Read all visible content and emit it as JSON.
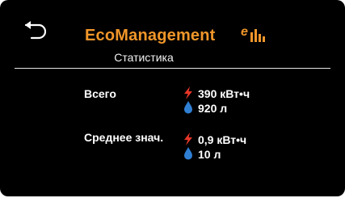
{
  "header": {
    "title": "EcoManagement",
    "subtitle": "Статистика",
    "logo_letter": "e"
  },
  "stats": {
    "total": {
      "label": "Всего",
      "energy": "390 кВт•ч",
      "water": "920 л"
    },
    "average": {
      "label": "Среднее знач.",
      "energy": "0,9 кВт•ч",
      "water": "10 л"
    }
  },
  "icons": {
    "back": "undo-arrow-icon",
    "logo": "eco-logo-icon",
    "energy": "lightning-bolt-icon",
    "water": "water-drop-icon"
  },
  "colors": {
    "background": "#000000",
    "accent": "#f0962a",
    "energy": "#e8362a",
    "water": "#2f7fd3",
    "text": "#ffffff"
  }
}
